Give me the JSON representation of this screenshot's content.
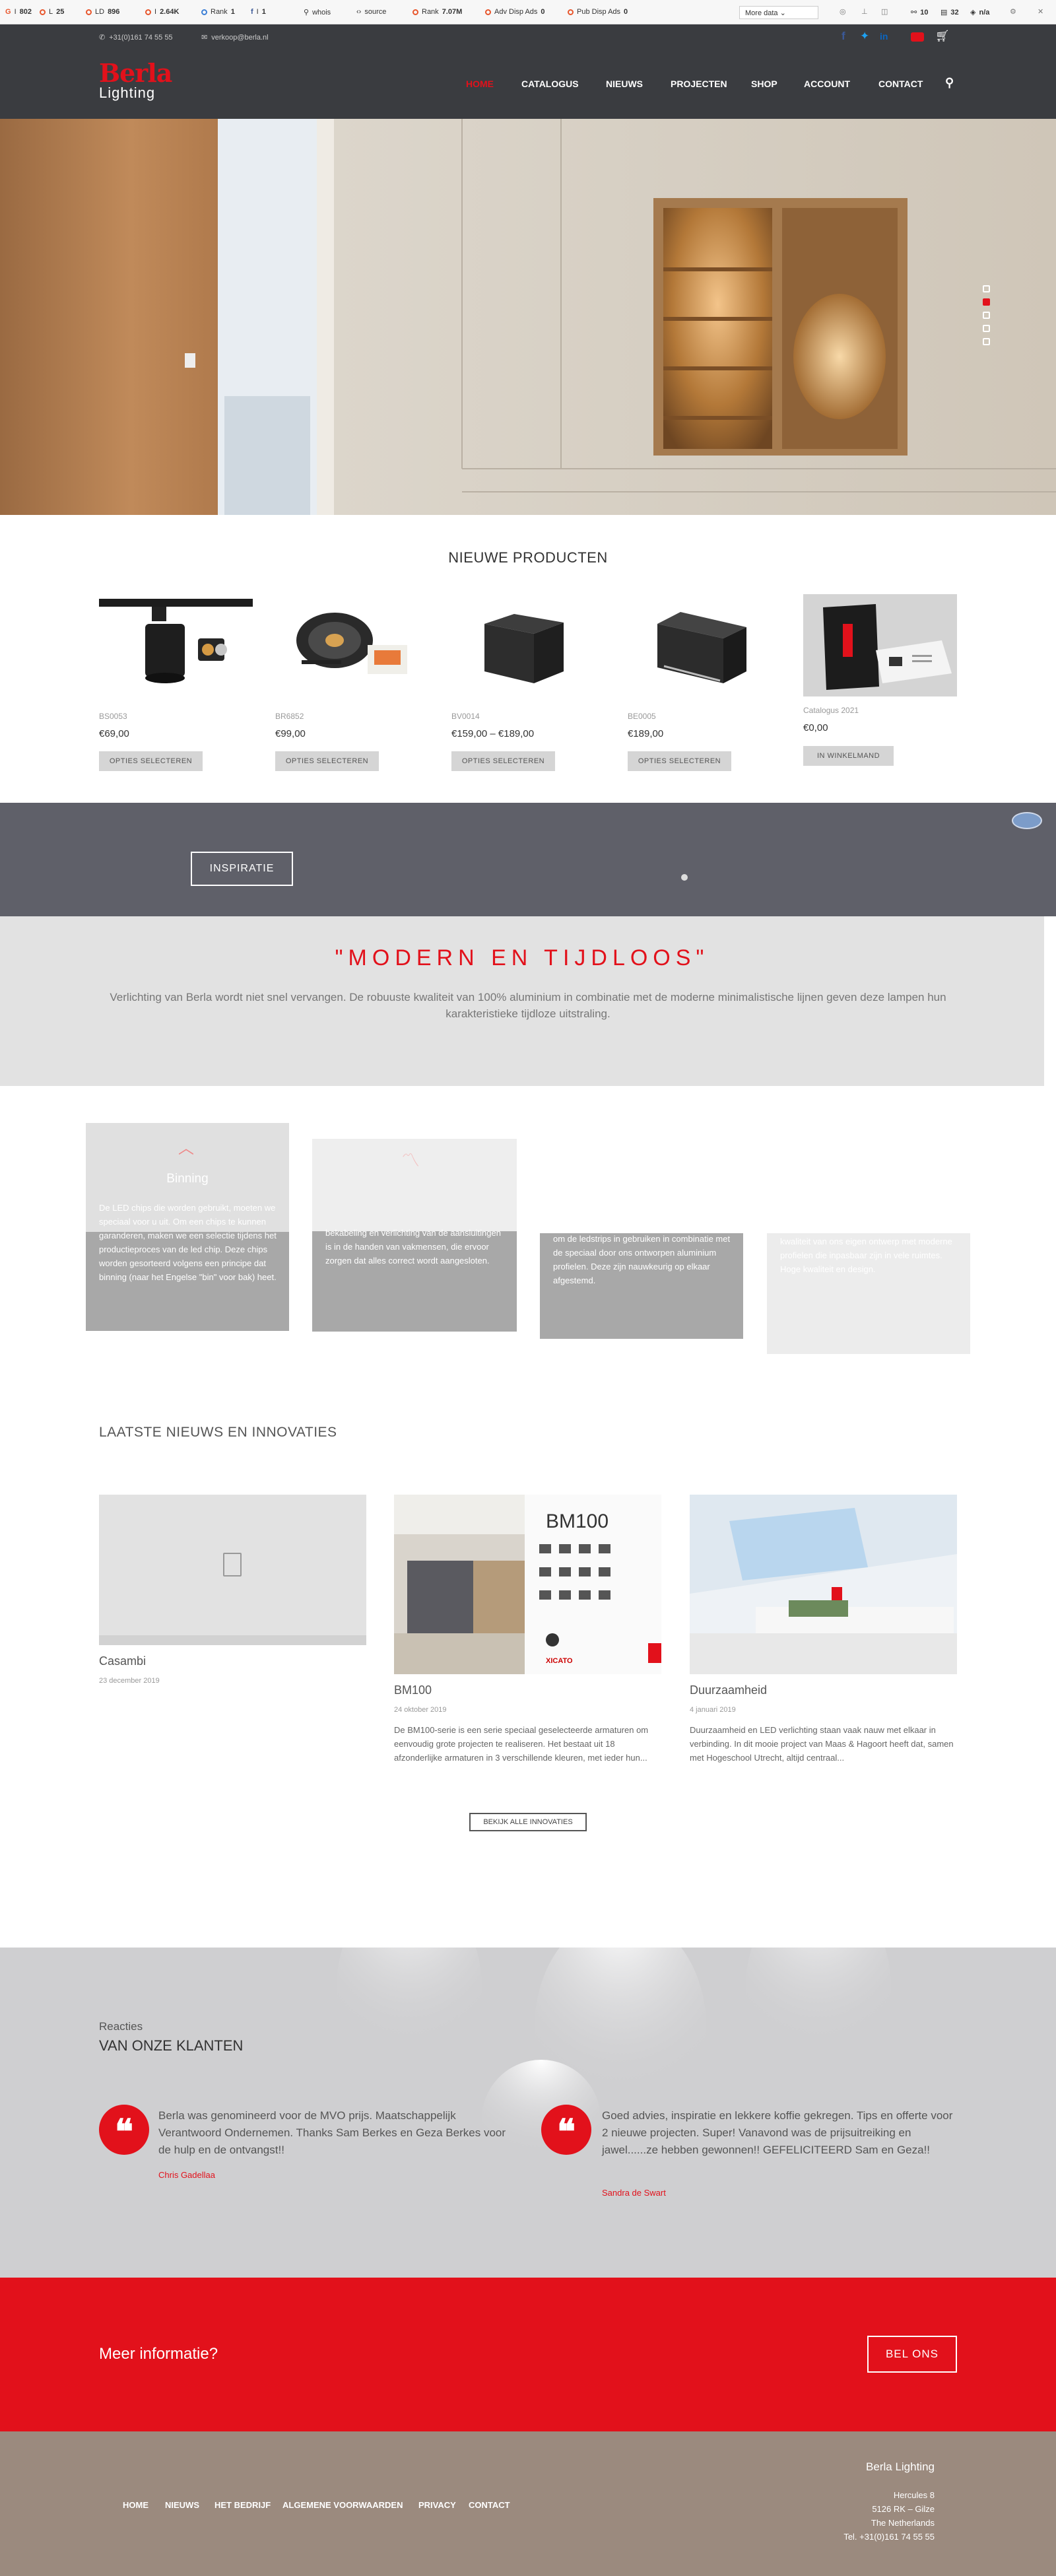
{
  "seo_bar": {
    "items": [
      {
        "label": "I",
        "value": "802"
      },
      {
        "label": "L",
        "value": "25"
      },
      {
        "label": "LD",
        "value": "896"
      },
      {
        "label": "I",
        "value": "2.64K"
      },
      {
        "label": "Rank",
        "value": "1"
      },
      {
        "label": "I",
        "value": "1"
      },
      {
        "label": "whois",
        "value": ""
      },
      {
        "label": "source",
        "value": ""
      },
      {
        "label": "Rank",
        "value": "7.07M"
      },
      {
        "label": "Adv Disp Ads",
        "value": "0"
      },
      {
        "label": "Pub Disp Ads",
        "value": "0"
      }
    ],
    "more_label": "More data",
    "right_values": [
      "10",
      "32",
      "n/a"
    ]
  },
  "header": {
    "phone": "+31(0)161 74 55 55",
    "email": "verkoop@berla.nl",
    "logo_main": "Berla",
    "logo_sub": "Lighting",
    "nav": [
      "HOME",
      "CATALOGUS",
      "NIEUWS",
      "PROJECTEN",
      "SHOP",
      "ACCOUNT",
      "CONTACT"
    ],
    "social_icons": [
      "facebook-icon",
      "twitter-icon",
      "linkedin-icon",
      "youtube-icon",
      "cart-icon"
    ]
  },
  "products": {
    "title": "NIEUWE PRODUCTEN",
    "items": [
      {
        "name": "BS0053",
        "price": "€69,00",
        "button": "OPTIES SELECTEREN"
      },
      {
        "name": "BR6852",
        "price": "€99,00",
        "button": "OPTIES SELECTEREN"
      },
      {
        "name": "BV0014",
        "price": "€159,00 – €189,00",
        "button": "OPTIES SELECTEREN"
      },
      {
        "name": "BE0005",
        "price": "€189,00",
        "button": "OPTIES SELECTEREN"
      },
      {
        "name": "Catalogus 2021",
        "price": "€0,00",
        "button": "IN WINKELMAND"
      }
    ]
  },
  "inspiration": {
    "button": "INSPIRATIE"
  },
  "quote": {
    "title": "\"MODERN EN TIJDLOOS\"",
    "text": "Verlichting van Berla wordt niet snel vervangen. De robuuste kwaliteit van 100% aluminium in combinatie met de moderne minimalistische lijnen geven deze lampen hun karakteristieke tijdloze uitstraling."
  },
  "features": [
    {
      "title": "Binning",
      "text": "De LED chips die worden gebruikt, moeten we speciaal voor u uit. Om een chips te kunnen garanderen, maken we een selectie tijdens het productieproces van de led chip. Deze chips worden gesorteerd volgens een principe dat binning (naar het Engelse \"bin\" voor bak) heet."
    },
    {
      "title": "",
      "text": "bekabeling en verlichting van de aansluitingen is in de handen van vakmensen, die ervoor zorgen dat alles correct wordt aangesloten."
    },
    {
      "title": "",
      "text": "om de ledstrips in gebruiken in combinatie met de speciaal door ons ontworpen aluminium profielen. Deze zijn nauwkeurig op elkaar afgestemd."
    },
    {
      "title": "",
      "text": "kwaliteit van ons eigen ontwerp met moderne profielen die inpasbaar zijn in vele ruimtes. Hoge kwaliteit en design."
    }
  ],
  "news": {
    "title": "LAATSTE NIEUWS EN INNOVATIES",
    "items": [
      {
        "title": "Casambi",
        "date": "23 december 2019",
        "excerpt": ""
      },
      {
        "title": "BM100",
        "date": "24 oktober 2019",
        "excerpt": "De BM100-serie is een serie speciaal geselecteerde armaturen om eenvoudig grote projecten te realiseren. Het bestaat uit 18 afzonderlijke armaturen in 3 verschillende kleuren, met ieder hun..."
      },
      {
        "title": "Duurzaamheid",
        "date": "4 januari 2019",
        "excerpt": "Duurzaamheid en LED verlichting staan vaak nauw met elkaar in verbinding. In dit mooie project van Maas & Hagoort heeft dat, samen met Hogeschool Utrecht, altijd centraal..."
      }
    ],
    "button": "BEKIJK ALLE INNOVATIES",
    "bm_label": "BM100",
    "bm_brand": "XICATO"
  },
  "testimonials": {
    "kicker": "Reacties",
    "title": "VAN ONZE KLANTEN",
    "items": [
      {
        "text": "Berla was genomineerd voor de MVO prijs. Maatschappelijk Verantwoord Ondernemen. Thanks Sam Berkes en Geza Berkes voor de hulp en de ontvangst!!",
        "name": "Chris Gadellaa"
      },
      {
        "text": "Goed advies, inspiratie en lekkere koffie gekregen. Tips en offerte voor 2 nieuwe projecten. Super! Vanavond was de prijsuitreiking en jawel......ze hebben gewonnen!! GEFELICITEERD Sam en Geza!!",
        "name": "Sandra de Swart"
      }
    ]
  },
  "cta": {
    "text": "Meer informatie?",
    "button": "BEL ONS"
  },
  "footer": {
    "nav": [
      "HOME",
      "NIEUWS",
      "HET BEDRIJF",
      "ALGEMENE VOORWAARDEN",
      "PRIVACY",
      "CONTACT"
    ],
    "company": "Berla Lighting",
    "address": [
      "Hercules 8",
      "5126 RK – Gilze",
      "The Netherlands",
      "Tel. +31(0)161 74 55 55"
    ]
  },
  "colors": {
    "brand_red": "#e2111b",
    "header_dark": "#3a3c40",
    "footer_brown": "#9b8a7e"
  }
}
